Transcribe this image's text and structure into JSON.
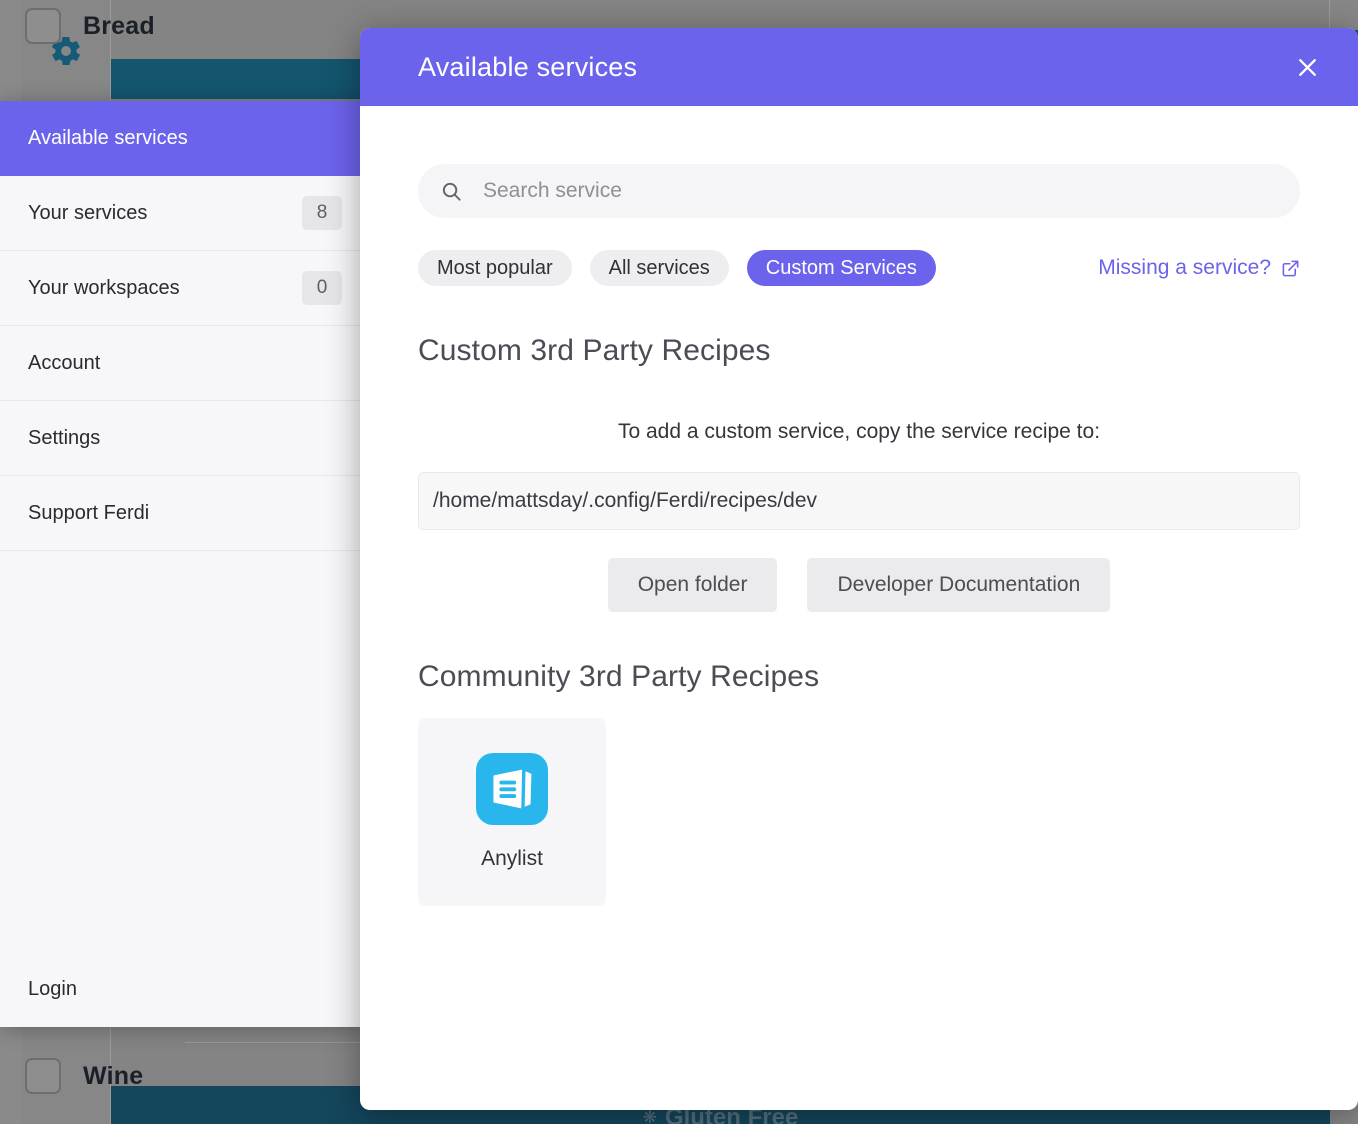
{
  "colors": {
    "accent": "#6c63ec",
    "teal_bar": "#14556f",
    "panel_bg": "#f7f7f9",
    "anylist_blue": "#29b6ed"
  },
  "background_app": {
    "gear_icon": "gear-icon",
    "rows": [
      {
        "label": "Bread",
        "checkbox_checked": false
      },
      {
        "label": "Wine",
        "checkbox_checked": false
      }
    ],
    "bottom_bar": {
      "icon": "sparkle-icon",
      "label": "Gluten Free"
    }
  },
  "settings_sidebar": {
    "items": [
      {
        "label": "Available services",
        "badge": null,
        "active": true,
        "name": "available-services"
      },
      {
        "label": "Your services",
        "badge": "8",
        "active": false,
        "name": "your-services"
      },
      {
        "label": "Your workspaces",
        "badge": "0",
        "active": false,
        "name": "your-workspaces"
      },
      {
        "label": "Account",
        "badge": null,
        "active": false,
        "name": "account"
      },
      {
        "label": "Settings",
        "badge": null,
        "active": false,
        "name": "settings"
      },
      {
        "label": "Support Ferdi",
        "badge": null,
        "active": false,
        "name": "support-ferdi"
      }
    ],
    "login_label": "Login"
  },
  "modal": {
    "title": "Available services",
    "close_icon": "close-icon",
    "search": {
      "icon": "search-icon",
      "placeholder": "Search service",
      "value": ""
    },
    "filters": [
      {
        "label": "Most popular",
        "active": false
      },
      {
        "label": "All services",
        "active": false
      },
      {
        "label": "Custom Services",
        "active": true
      }
    ],
    "missing_link": {
      "label": "Missing a service?",
      "icon": "external-link-icon"
    },
    "custom_section": {
      "heading": "Custom 3rd Party Recipes",
      "help_text": "To add a custom service, copy the service recipe to:",
      "path_value": "/home/mattsday/.config/Ferdi/recipes/dev",
      "buttons": [
        {
          "label": "Open folder",
          "name": "open-folder-button"
        },
        {
          "label": "Developer Documentation",
          "name": "developer-documentation-button"
        }
      ]
    },
    "community_section": {
      "heading": "Community 3rd Party Recipes",
      "recipes": [
        {
          "name": "Anylist",
          "icon": "anylist-icon"
        }
      ]
    }
  }
}
